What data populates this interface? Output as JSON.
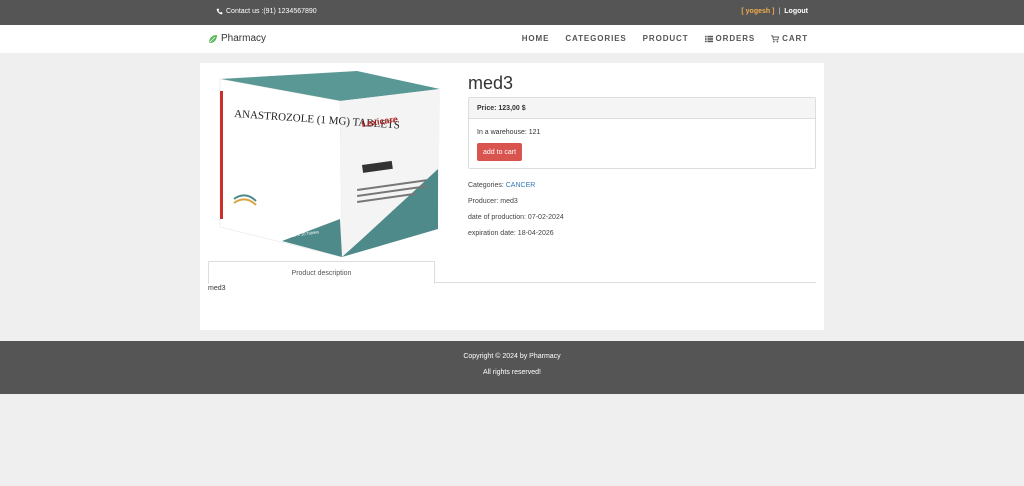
{
  "topbar": {
    "contact_text": "Contact us :(91) 1234567890",
    "contact_icon": "phone-icon",
    "user_label": "[ yogesh ]",
    "separator": "|",
    "logout_label": "Logout"
  },
  "navbar": {
    "brand": "Pharmacy",
    "brand_icon": "leaf-icon",
    "menu": [
      {
        "label": "HOME"
      },
      {
        "label": "CATEGORIES"
      },
      {
        "label": "PRODUCT"
      },
      {
        "label": "ORDERS",
        "icon": "list-icon"
      },
      {
        "label": "CART",
        "icon": "cart-icon"
      }
    ]
  },
  "product": {
    "name": "med3",
    "image": {
      "box_title": "ANASTROZOLE (1 MG) TABLETS",
      "brand": "Lexicare",
      "count_label": "10 X 10 Tablets"
    },
    "price_label": "Price: 123,00 $",
    "warehouse": "In a warehouse: 121",
    "add_to_cart_label": "add to cart",
    "categories_label": "Categories:",
    "category": "CANCER",
    "producer": "Producer: med3",
    "production_date": "date of production: 07-02-2024",
    "expiration_date": "expiration date: 18-04-2026",
    "tab_label": "Product description",
    "description": "med3"
  },
  "footer": {
    "copyright": "Copyright © 2024 by Pharmacy",
    "rights": "All rights reserved!"
  },
  "colors": {
    "bar_bg": "#555555",
    "user_accent": "#f0ad4e",
    "button_red": "#d9534f",
    "link_blue": "#337ab7",
    "box_teal": "#4e8a89"
  }
}
